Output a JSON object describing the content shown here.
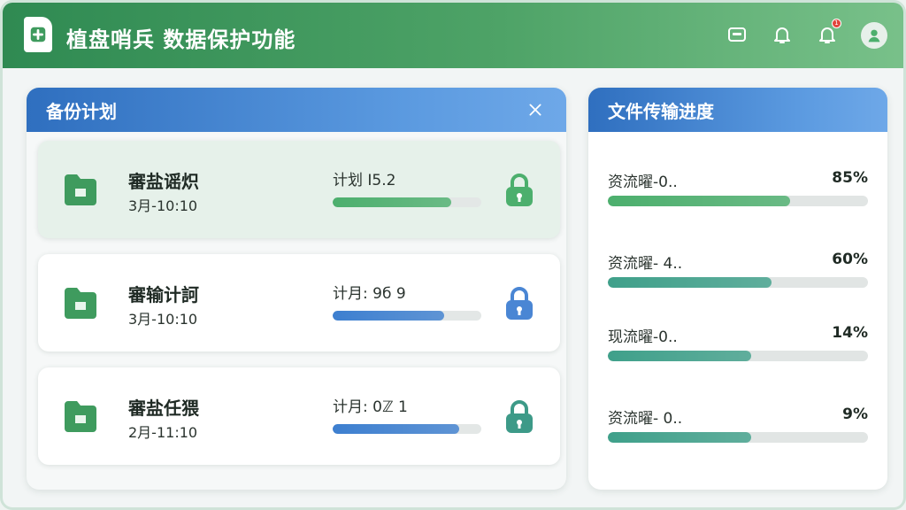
{
  "header": {
    "title": "植盘哨兵 数据保护功能",
    "icons": [
      "app-logo-icon",
      "window-icon",
      "bell-icon",
      "notification-bell-icon",
      "user-avatar-icon"
    ],
    "notification_badge": "1"
  },
  "backup_panel": {
    "title": "备份计划",
    "close_icon": "close-icon",
    "plans": [
      {
        "name": "審盐谣炽",
        "time": "3月-10:10",
        "status": "计划 I5.2",
        "progress": 0.8,
        "color": "#4caf6d",
        "lock_color": "#4caf6d",
        "active": true
      },
      {
        "name": "審输计訶",
        "time": "3月-10:10",
        "status": "计月: 9б 9",
        "progress": 0.75,
        "color": "#3d7fd0",
        "lock_color": "#4a86d4",
        "active": false
      },
      {
        "name": "審盐任猥",
        "time": "2月-11:10",
        "status": "计月: 0ℤ 1",
        "progress": 0.85,
        "color": "#3d7fd0",
        "lock_color": "#3d9a88",
        "active": false
      }
    ]
  },
  "transfer_panel": {
    "title": "文件传输进度",
    "items": [
      {
        "name": "资流曜-0..",
        "percent_label": "85%",
        "progress": 0.7,
        "color": "#4caf6d"
      },
      {
        "name": "资流曜- 4..",
        "percent_label": "60%",
        "progress": 0.63,
        "color": "#3fa08a"
      },
      {
        "name": "现流曜-0..",
        "percent_label": "14%",
        "progress": 0.55,
        "color": "#3fa08a"
      },
      {
        "name": "资流曜- 0..",
        "percent_label": "9%",
        "progress": 0.55,
        "color": "#3fa08a"
      }
    ]
  },
  "colors": {
    "header_green": "#2f8a52",
    "panel_blue": "#2f6fbf",
    "accent_green": "#4caf6d"
  }
}
